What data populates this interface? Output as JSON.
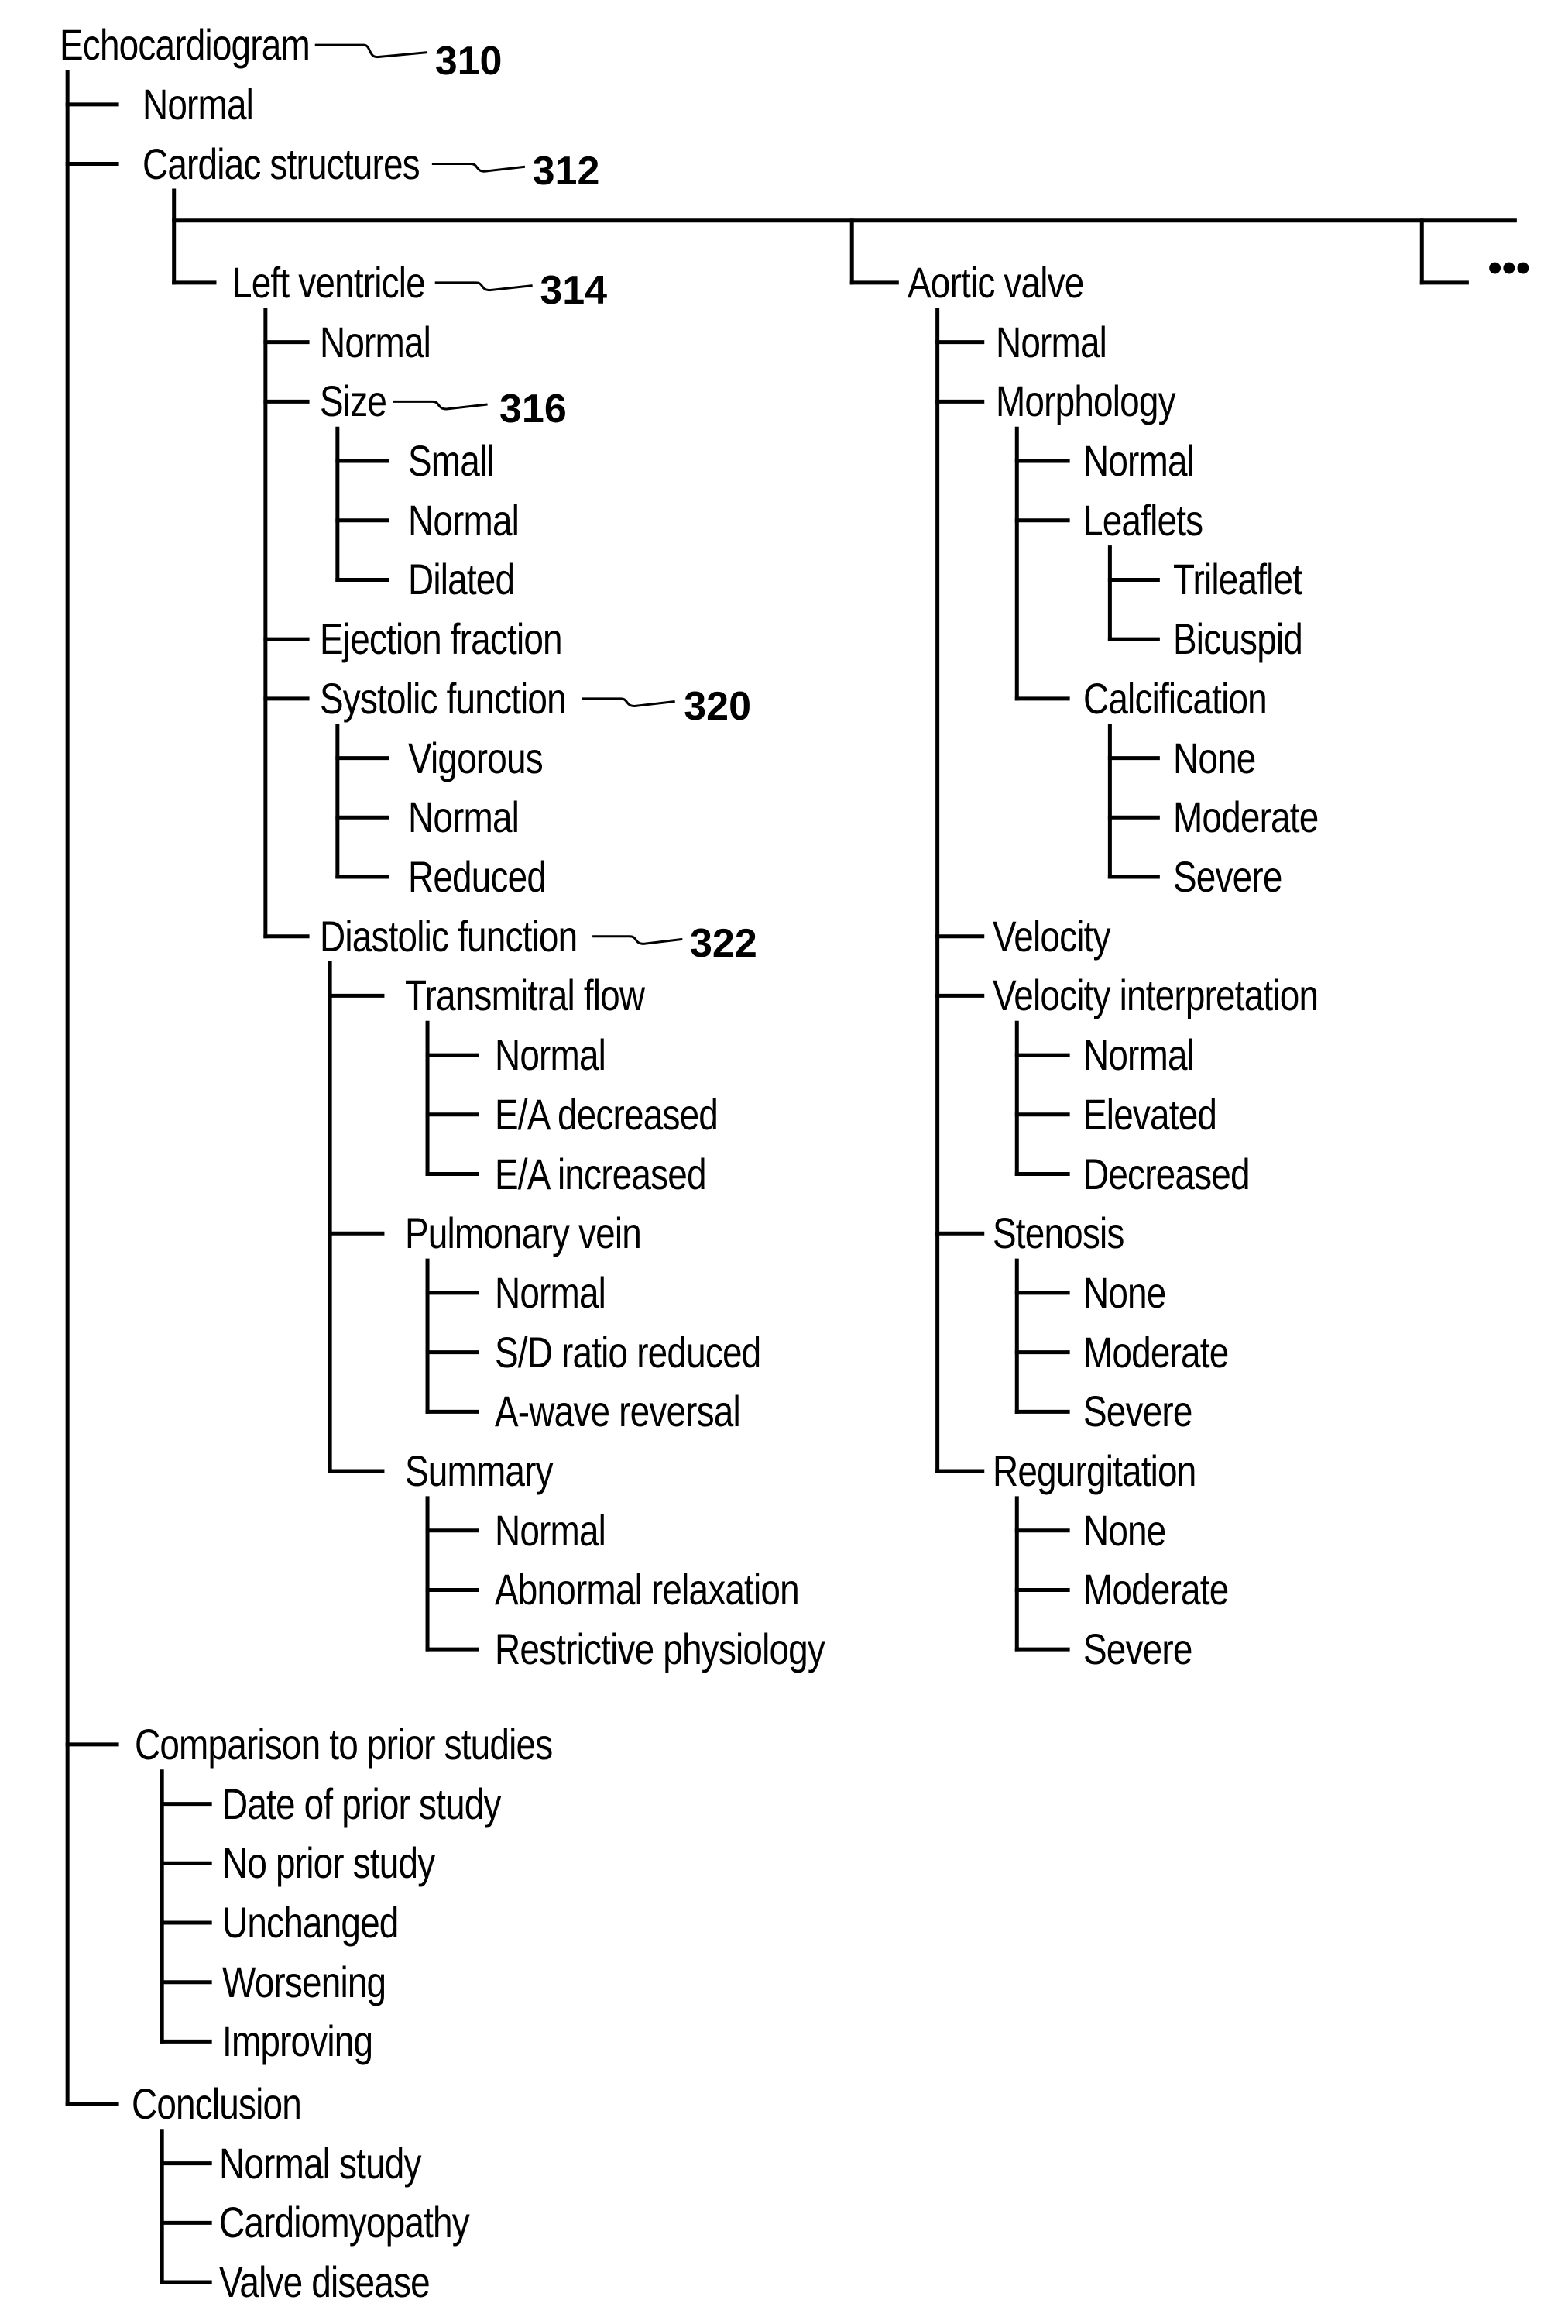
{
  "diagram": {
    "root": {
      "label": "Echocardiogram",
      "ref": "310"
    },
    "root_children": {
      "normal": "Normal",
      "cardiac_structures": {
        "label": "Cardiac structures",
        "ref": "312"
      },
      "comparison": {
        "label": "Comparison to prior studies",
        "items": [
          "Date of prior study",
          "No prior study",
          "Unchanged",
          "Worsening",
          "Improving"
        ]
      },
      "conclusion": {
        "label": "Conclusion",
        "items": [
          "Normal study",
          "Cardiomyopathy",
          "Valve disease"
        ]
      }
    },
    "left_ventricle": {
      "label": "Left ventricle",
      "ref": "314",
      "normal": "Normal",
      "size": {
        "label": "Size",
        "ref": "316",
        "items": [
          "Small",
          "Normal",
          "Dilated"
        ]
      },
      "ejection_fraction": "Ejection fraction",
      "systolic": {
        "label": "Systolic function",
        "ref": "320",
        "items": [
          "Vigorous",
          "Normal",
          "Reduced"
        ]
      },
      "diastolic": {
        "label": "Diastolic function",
        "ref": "322",
        "transmitral": {
          "label": "Transmitral flow",
          "items": [
            "Normal",
            "E/A decreased",
            "E/A increased"
          ]
        },
        "pulmonary": {
          "label": "Pulmonary vein",
          "items": [
            "Normal",
            "S/D ratio reduced",
            "A-wave reversal"
          ]
        },
        "summary": {
          "label": "Summary",
          "items": [
            "Normal",
            "Abnormal relaxation",
            "Restrictive physiology"
          ]
        }
      }
    },
    "aortic_valve": {
      "label": "Aortic valve",
      "normal": "Normal",
      "morphology": {
        "label": "Morphology",
        "normal": "Normal",
        "leaflets": {
          "label": "Leaflets",
          "items": [
            "Trileaflet",
            "Bicuspid"
          ]
        },
        "calcification": {
          "label": "Calcification",
          "items": [
            "None",
            "Moderate",
            "Severe"
          ]
        }
      },
      "velocity": "Velocity",
      "velocity_interpretation": {
        "label": "Velocity interpretation",
        "items": [
          "Normal",
          "Elevated",
          "Decreased"
        ]
      },
      "stenosis": {
        "label": "Stenosis",
        "items": [
          "None",
          "Moderate",
          "Severe"
        ]
      },
      "regurgitation": {
        "label": "Regurgitation",
        "items": [
          "None",
          "Moderate",
          "Severe"
        ]
      }
    },
    "more_branches": "..."
  }
}
